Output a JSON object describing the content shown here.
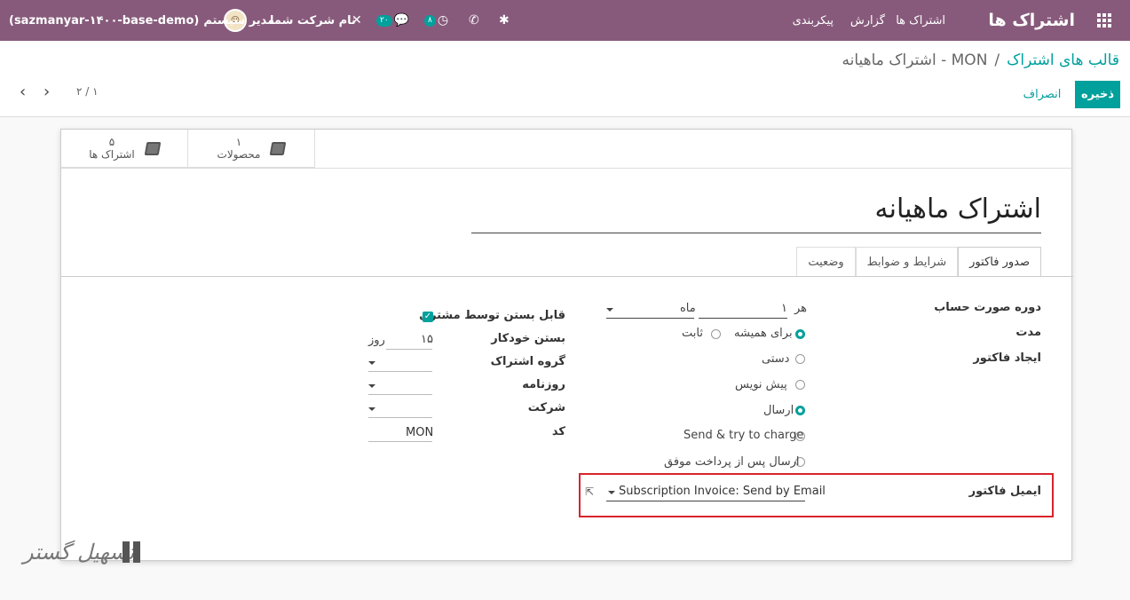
{
  "navbar": {
    "app_name": "اشتراک ها",
    "menu": [
      "اشتراک ها",
      "گزارش",
      "پیکربندی"
    ],
    "db_name": "(sazmanyar-۱۴۰۰-base-demo)",
    "user_name": "مدیر سیستم",
    "company": "نام شرکت شما",
    "chat_count": "۲۰",
    "activity_count": "۸",
    "icons": [
      "apps-icon",
      "bug-icon",
      "phone-icon",
      "clock-icon",
      "chat-icon",
      "tools-icon"
    ]
  },
  "control_panel": {
    "breadcrumb_parent": "قالب های اشتراک",
    "breadcrumb_sep": "/",
    "breadcrumb_current": "MON - اشتراک ماهیانه",
    "save_label": "ذخیره",
    "discard_label": "انصراف",
    "pager": "۲ / ۱"
  },
  "stat_buttons": [
    {
      "value": "۵",
      "label": "اشتراک ها"
    },
    {
      "value": "۱",
      "label": "محصولات"
    }
  ],
  "form": {
    "title": "اشتراک ماهیانه",
    "tabs": [
      "صدور فاکتور",
      "شرایط و ضوابط",
      "وضعیت"
    ],
    "labels": {
      "billing_period": "دوره صورت حساب",
      "duration": "مدت",
      "invoice_creation": "ایجاد فاکتور",
      "invoice_email": "ایمیل فاکتور",
      "customer_closable": "قابل بستن توسط مشتری",
      "auto_close": "بستن خودکار",
      "subscription_group": "گروه اشتراک",
      "journal": "روزنامه",
      "company": "شرکت",
      "code": "کد"
    },
    "billing_every": "هر",
    "billing_interval": "۱",
    "billing_unit": "ماه",
    "duration_options": [
      "برای همیشه",
      "ثابت"
    ],
    "invoice_options": [
      "دستی",
      "پیش نویس",
      "ارسال",
      "Send & try to charge",
      "ارسال پس از پرداخت موفق"
    ],
    "invoice_email_value": "Subscription Invoice: Send by Email",
    "auto_close_value": "۱۵",
    "auto_close_unit": "روز",
    "code_value": "MON"
  },
  "watermark": "تسهیل گستر"
}
